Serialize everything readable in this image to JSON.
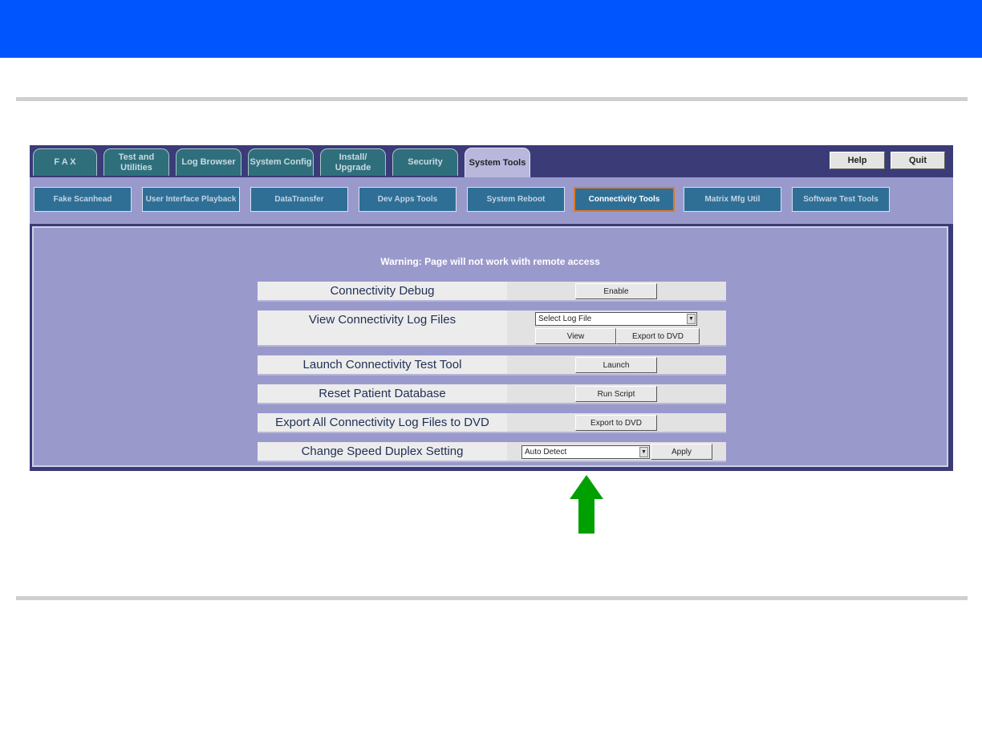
{
  "tabs": [
    {
      "label": "F A X"
    },
    {
      "label": "Test and Utilities"
    },
    {
      "label": "Log Browser"
    },
    {
      "label": "System Config"
    },
    {
      "label": "Install/ Upgrade"
    },
    {
      "label": "Security"
    },
    {
      "label": "System Tools",
      "active": true
    }
  ],
  "top_buttons": {
    "help": "Help",
    "quit": "Quit"
  },
  "subtabs": [
    {
      "label": "Fake Scanhead"
    },
    {
      "label": "User Interface Playback"
    },
    {
      "label": "DataTransfer"
    },
    {
      "label": "Dev Apps Tools"
    },
    {
      "label": "System Reboot"
    },
    {
      "label": "Connectivity Tools",
      "active": true
    },
    {
      "label": "Matrix Mfg Util"
    },
    {
      "label": "Software Test Tools"
    }
  ],
  "warning": "Warning: Page will not work with remote access",
  "rows": {
    "debug": {
      "label": "Connectivity Debug",
      "button": "Enable"
    },
    "logs": {
      "label": "View Connectivity Log Files",
      "select": "Select Log File",
      "view": "View",
      "export": "Export to DVD"
    },
    "launch": {
      "label": "Launch Connectivity Test Tool",
      "button": "Launch"
    },
    "reset": {
      "label": "Reset Patient Database",
      "button": "Run Script"
    },
    "exportall": {
      "label": "Export All Connectivity Log Files to DVD",
      "button": "Export to DVD"
    },
    "speed": {
      "label": "Change Speed Duplex Setting",
      "select": "Auto Detect",
      "button": "Apply"
    }
  },
  "colors": {
    "header": "#0055ff",
    "arrow": "#00a000",
    "active_outline": "#e07828"
  }
}
